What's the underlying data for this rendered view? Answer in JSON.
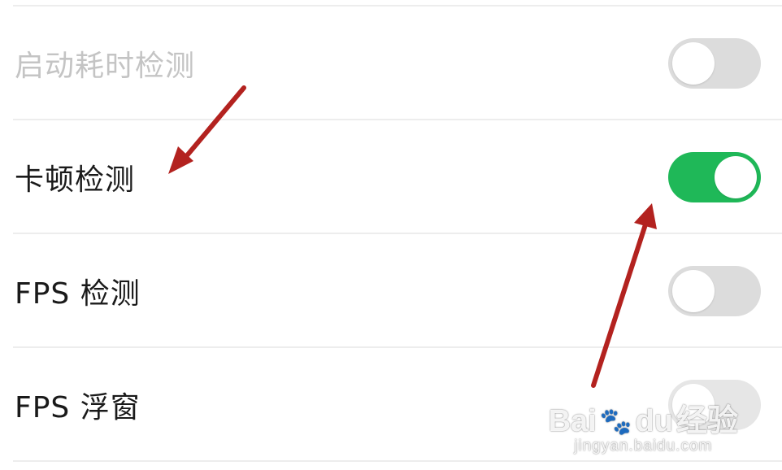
{
  "settings": [
    {
      "label": "启动耗时检测",
      "enabled": false,
      "disabled": true
    },
    {
      "label": "卡顿检测",
      "enabled": true,
      "disabled": false
    },
    {
      "label": "FPS 检测",
      "enabled": false,
      "disabled": false
    },
    {
      "label": "FPS 浮窗",
      "enabled": false,
      "disabled": false
    }
  ],
  "watermark": {
    "brand_prefix": "Bai",
    "brand_suffix": "du",
    "brand_cn": "经验",
    "url": "jingyan.baidu.com"
  },
  "colors": {
    "toggle_on": "#1fb858",
    "toggle_off": "#dcdcdc",
    "arrow": "#b3221f"
  }
}
